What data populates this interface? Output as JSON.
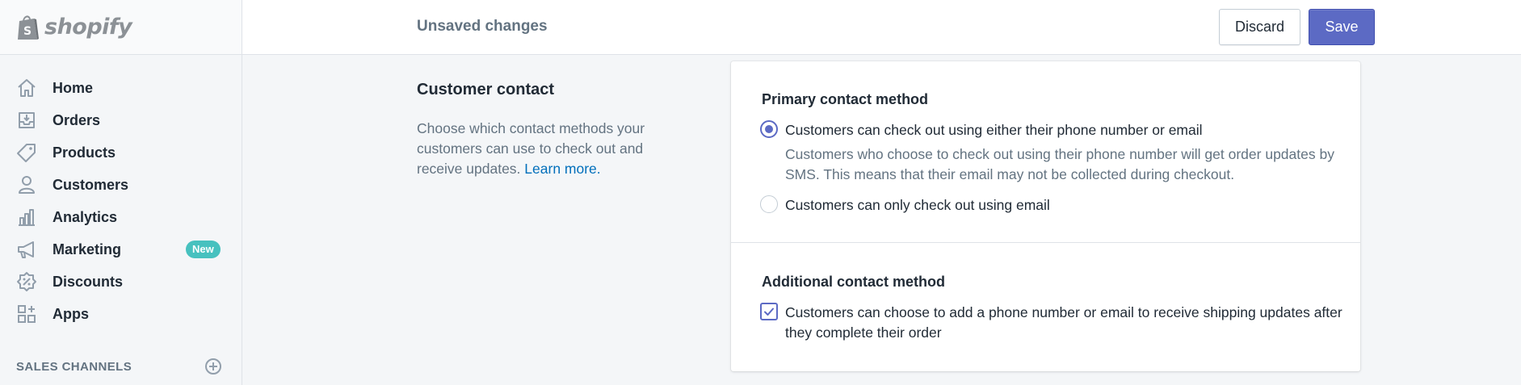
{
  "brand": {
    "name": "shopify",
    "logo_icon": "shopify-bag-icon"
  },
  "nav": {
    "items": [
      {
        "label": "Home",
        "icon": "home-icon"
      },
      {
        "label": "Orders",
        "icon": "orders-icon"
      },
      {
        "label": "Products",
        "icon": "tag-icon"
      },
      {
        "label": "Customers",
        "icon": "person-icon"
      },
      {
        "label": "Analytics",
        "icon": "bar-chart-icon"
      },
      {
        "label": "Marketing",
        "icon": "megaphone-icon",
        "badge": "New"
      },
      {
        "label": "Discounts",
        "icon": "discount-icon"
      },
      {
        "label": "Apps",
        "icon": "apps-icon"
      }
    ],
    "sales_channels_label": "SALES CHANNELS",
    "add_channel_icon": "plus-circle-icon"
  },
  "topbar": {
    "status": "Unsaved changes",
    "discard_label": "Discard",
    "save_label": "Save"
  },
  "section": {
    "title": "Customer contact",
    "description": "Choose which contact methods your customers can use to check out and receive updates.",
    "link": "Learn more."
  },
  "primary": {
    "title": "Primary contact method",
    "options": [
      {
        "label": "Customers can check out using either their phone number or email",
        "help": "Customers who choose to check out using their phone number will get order updates by SMS. This means that their email may not be collected during checkout.",
        "checked": true
      },
      {
        "label": "Customers can only check out using email",
        "checked": false
      }
    ]
  },
  "additional": {
    "title": "Additional contact method",
    "option": {
      "label": "Customers can choose to add a phone number or email to receive shipping updates after they complete their order",
      "checked": true
    }
  },
  "colors": {
    "accent": "#5c6ac4",
    "badge": "#47c1bf",
    "link": "#006fbb",
    "muted": "#637381"
  }
}
